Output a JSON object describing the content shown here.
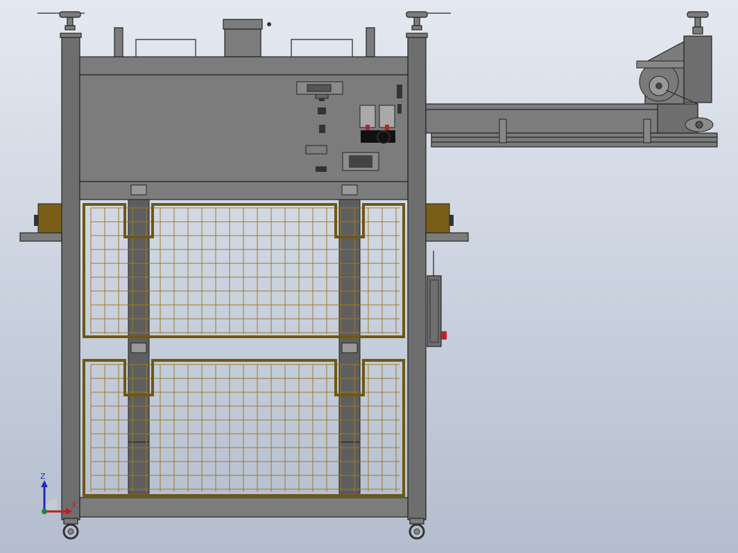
{
  "triad": {
    "z_label": "Z",
    "x_label": "X",
    "z_color": "#1f2bb0",
    "x_color": "#c01c1c",
    "y_color": "#1a8a2e"
  },
  "colors": {
    "frame": "#7c7c7c",
    "mesh": "#9b7a27",
    "cage_frame": "#6e5712",
    "brackets": "#7a5e18",
    "stop_button": "#c02020"
  }
}
